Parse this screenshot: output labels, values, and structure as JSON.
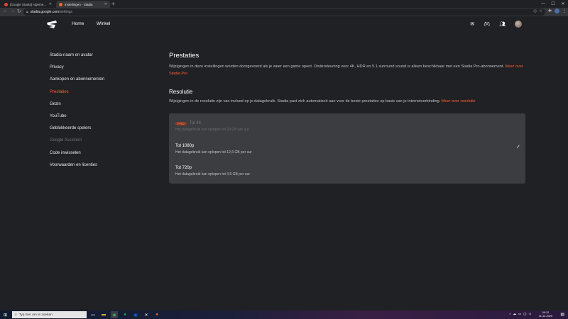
{
  "browser": {
    "tabs": [
      {
        "title": "[Google Stadia] Algemene onvo",
        "favicon_color": "#ea4335"
      },
      {
        "title": "Instellingen - Stadia",
        "favicon_color": "#ff5f35"
      }
    ],
    "url_host": "stadia.google.com",
    "url_path": "/settings"
  },
  "header": {
    "nav": [
      "Home",
      "Winkel"
    ]
  },
  "sidebar": {
    "items": [
      {
        "label": "Stadia-naam en avatar",
        "state": "normal"
      },
      {
        "label": "Privacy",
        "state": "normal"
      },
      {
        "label": "Aankopen en abonnementen",
        "state": "normal"
      },
      {
        "label": "Prestaties",
        "state": "active"
      },
      {
        "label": "Gezin",
        "state": "normal"
      },
      {
        "label": "YouTube",
        "state": "normal"
      },
      {
        "label": "Geblokkeerde spelers",
        "state": "normal"
      },
      {
        "label": "Google Assistent",
        "state": "disabled"
      },
      {
        "label": "Code inwisselen",
        "state": "normal"
      },
      {
        "label": "Voorwaarden en licenties",
        "state": "normal"
      }
    ]
  },
  "main": {
    "title": "Prestaties",
    "description": "Wijzigingen in deze instellingen worden doorgevoerd als je weer een game opent. Ondersteuning voor 4K, HDR en 5.1 surround sound is alleen beschikbaar met een Stadia Pro-abonnement.",
    "description_link": "Meer over Stadia Pro",
    "resolution_title": "Resolutie",
    "resolution_description": "Wijzigingen in de resolutie zijn van invloed op je datagebruik. Stadia past zich automatisch aan voor de beste prestaties op basis van je internetverbinding.",
    "resolution_link": "Meer over resolutie",
    "options": [
      {
        "badge": "PRO",
        "title": "Tot 4K",
        "subtitle": "Het datagebruik kan oplopen tot 20 GB per uur",
        "state": "disabled"
      },
      {
        "title": "Tot 1080p",
        "subtitle": "Het datagebruik kan oplopen tot 12,6 GB per uur",
        "state": "selected"
      },
      {
        "title": "Tot 720p",
        "subtitle": "Het datagebruik kan oplopen tot 4,5 GB per uur",
        "state": "normal"
      }
    ]
  },
  "taskbar": {
    "search_placeholder": "Typ hier om te zoeken",
    "time": "09:12",
    "date": "11-12-2020"
  },
  "colors": {
    "accent": "#ff5f35",
    "background": "#202124",
    "card": "#3c3d40"
  }
}
